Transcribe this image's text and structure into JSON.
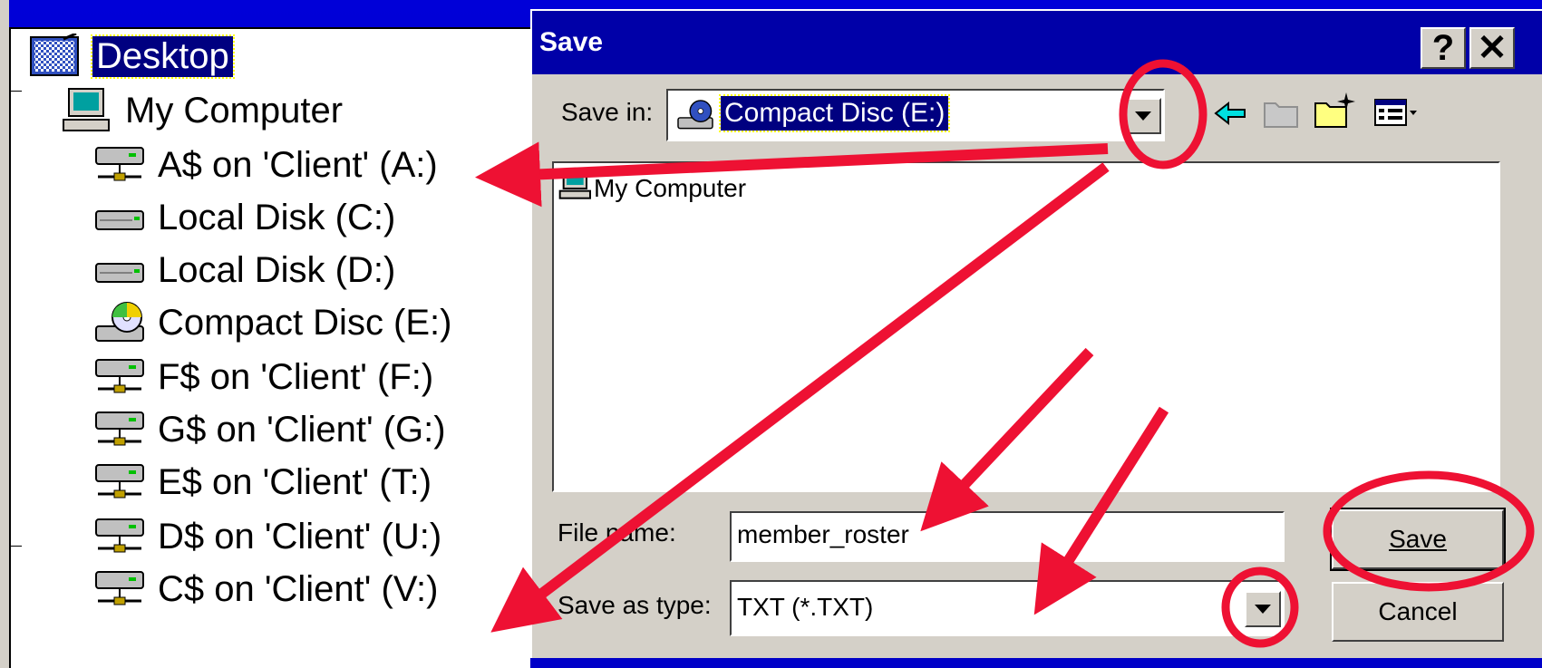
{
  "dialog": {
    "title": "Save",
    "help_label": "?",
    "close_label": "✕",
    "save_in_label": "Save in:",
    "save_in_value": "Compact Disc (E:)",
    "list_items": [
      "My Computer"
    ],
    "file_name_label": "File name:",
    "file_name_value": "member_roster",
    "save_as_type_label": "Save as type:",
    "save_as_type_value": "TXT (*.TXT)",
    "save_button": "Save",
    "cancel_button": "Cancel"
  },
  "tree": {
    "items": [
      {
        "label": "Desktop",
        "icon": "desktop-icon",
        "selected": true
      },
      {
        "label": "My Computer",
        "icon": "computer-icon"
      },
      {
        "label": "A$ on 'Client' (A:)",
        "icon": "network-drive-icon"
      },
      {
        "label": "Local Disk (C:)",
        "icon": "local-disk-icon"
      },
      {
        "label": "Local Disk (D:)",
        "icon": "local-disk-icon"
      },
      {
        "label": "Compact Disc (E:)",
        "icon": "cd-drive-icon"
      },
      {
        "label": "F$ on 'Client' (F:)",
        "icon": "network-drive-icon"
      },
      {
        "label": "G$ on 'Client' (G:)",
        "icon": "network-drive-icon"
      },
      {
        "label": "E$ on 'Client' (T:)",
        "icon": "network-drive-icon"
      },
      {
        "label": "D$ on 'Client' (U:)",
        "icon": "network-drive-icon"
      },
      {
        "label": "C$ on 'Client' (V:)",
        "icon": "network-drive-icon"
      }
    ]
  },
  "colors": {
    "annotation": "#ee1133",
    "title_bar": "#0000a8",
    "background": "#0000c8"
  }
}
